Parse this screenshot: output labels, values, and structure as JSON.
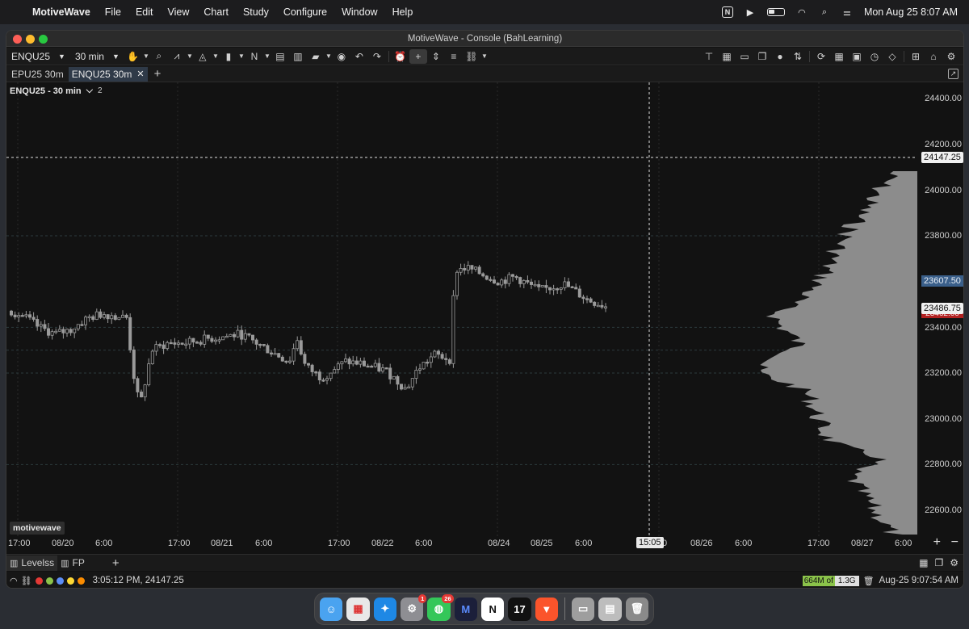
{
  "menubar": {
    "app_name": "MotiveWave",
    "menus": [
      "File",
      "Edit",
      "View",
      "Chart",
      "Study",
      "Configure",
      "Window",
      "Help"
    ],
    "clock": "Mon Aug 25  8:07 AM"
  },
  "window": {
    "title": "MotiveWave - Console (BahLearning)"
  },
  "toolbar": {
    "symbol": "ENQU25",
    "interval": "30 min",
    "bar_type_label": "N"
  },
  "tabs": [
    {
      "label": "EPU25 30m",
      "active": false
    },
    {
      "label": "ENQU25 30m",
      "active": true
    }
  ],
  "chart": {
    "label": "ENQU25 - 30 min",
    "study_count": "2",
    "watermark": "motivewave",
    "y_labels": [
      "24400.00",
      "24200.00",
      "24000.00",
      "23800.00",
      "23400.00",
      "23200.00",
      "23000.00",
      "22800.00",
      "22600.00"
    ],
    "crosshair_price": "24147.25",
    "blue_price": "23607.50",
    "last_price": "23486.75",
    "red_price": "23462.00",
    "x_labels": [
      "17:00",
      "08/20",
      "6:00",
      "17:00",
      "08/21",
      "6:00",
      "17:00",
      "08/22",
      "6:00",
      "08/24",
      "08/25",
      "6:00",
      "08/26",
      "6:00",
      "17:00",
      "08/27",
      "6:00"
    ],
    "x_label_partial": "0",
    "crosshair_time": "15:05"
  },
  "panels": [
    {
      "label": "Levelss",
      "active": true
    },
    {
      "label": "FP",
      "active": false
    }
  ],
  "status": {
    "text": "3:05:12 PM, 24147.25",
    "memory_used": "664M",
    "memory_of": " of ",
    "memory_total": "1.3G",
    "time": "Aug-25 9:07:54 AM",
    "dot_colors": [
      "#e53935",
      "#8bc34a",
      "#5c8df6",
      "#fdd835",
      "#fb8c00"
    ]
  },
  "dock": {
    "badge_settings": "1",
    "badge_messages": "26"
  },
  "colors": {
    "grid": "#2a2a2a",
    "candle": "#9a9a9a",
    "profile": "#8c8c8c"
  }
}
